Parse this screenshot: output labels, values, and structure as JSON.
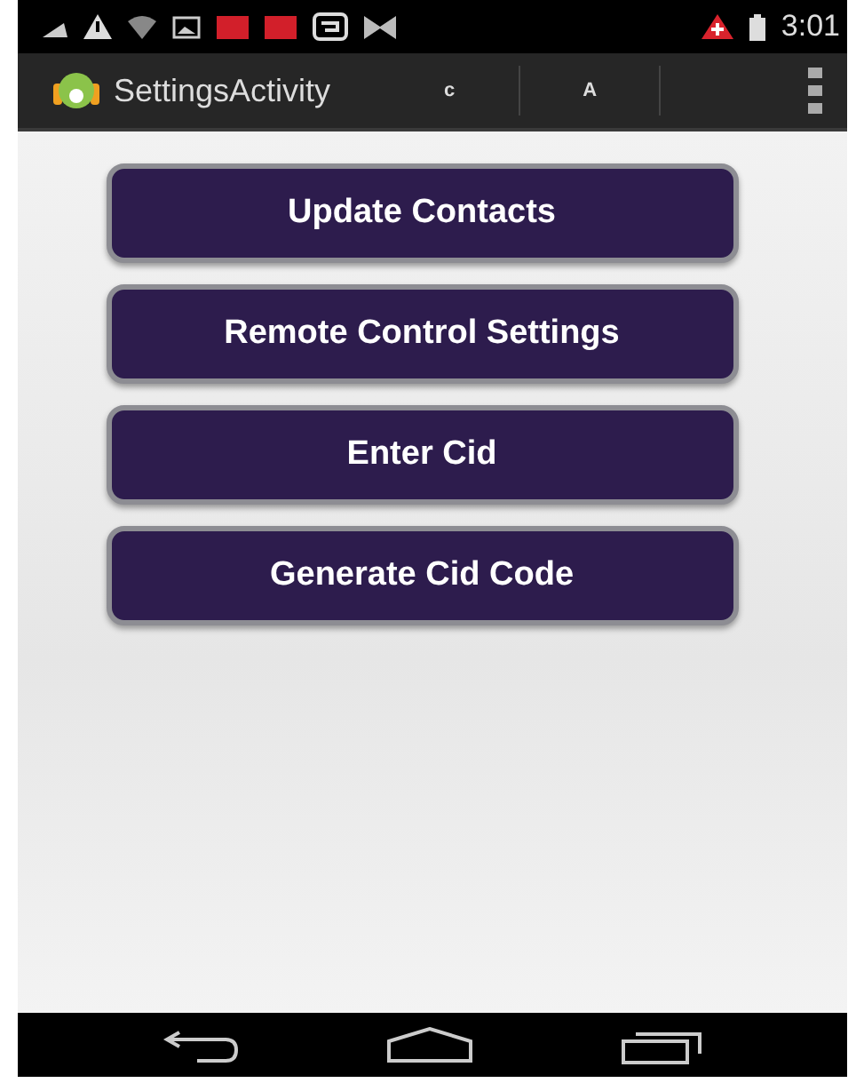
{
  "status_bar": {
    "time": "3:01"
  },
  "action_bar": {
    "title": "SettingsActivity",
    "actions": [
      "c",
      "A"
    ]
  },
  "buttons": [
    "Update Contacts",
    "Remote Control Settings",
    "Enter Cid",
    "Generate Cid Code"
  ]
}
